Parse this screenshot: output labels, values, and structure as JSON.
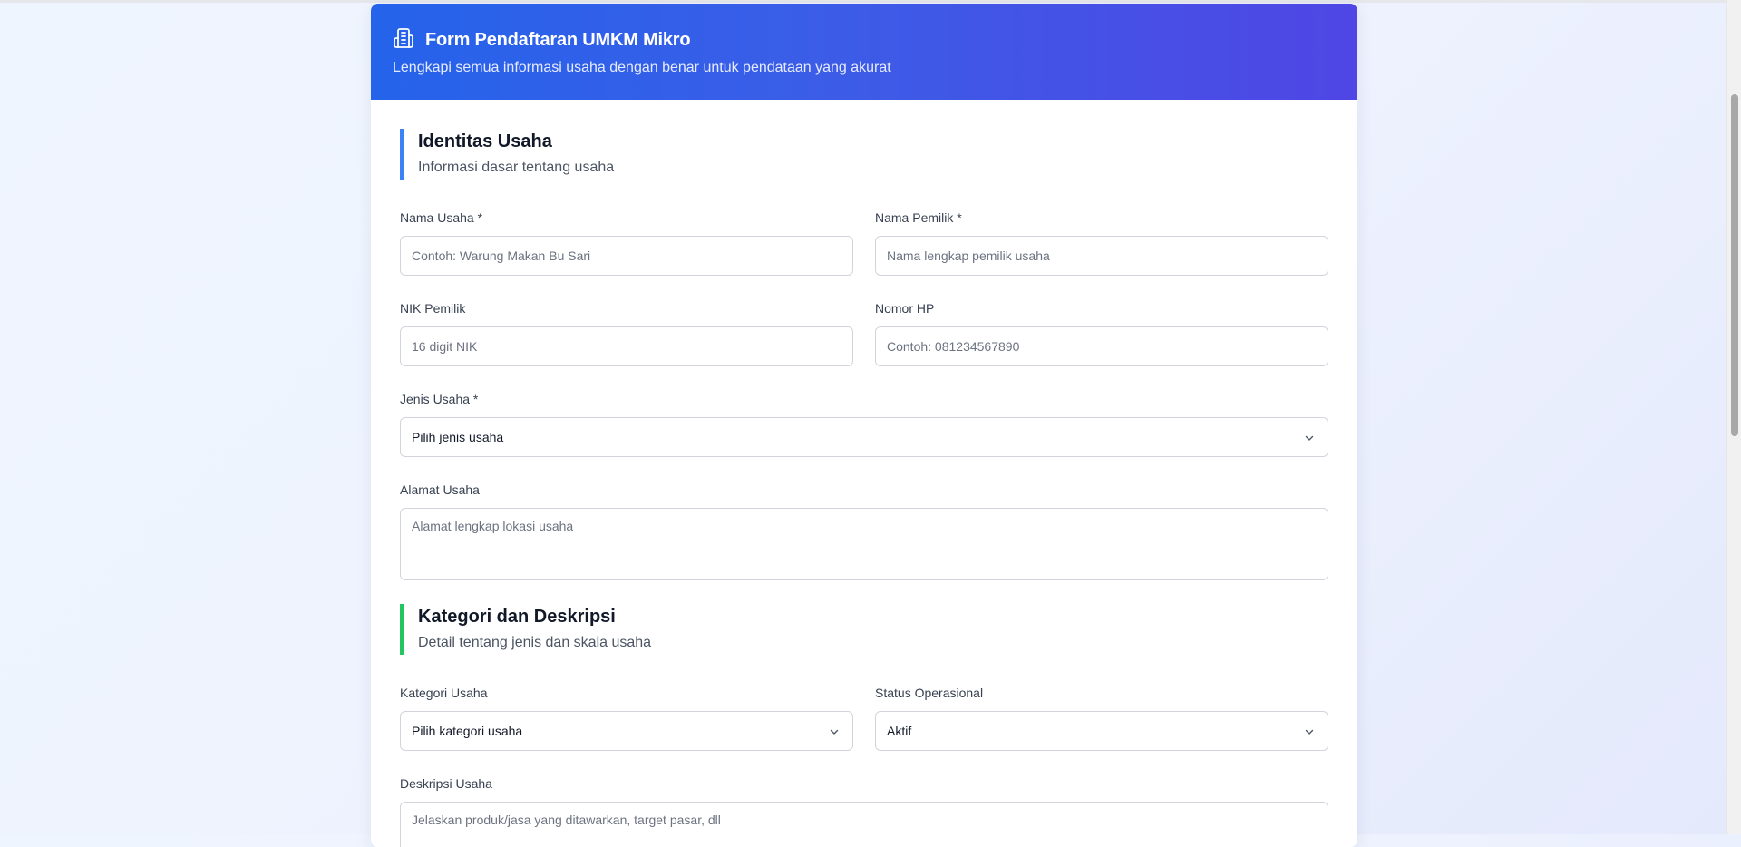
{
  "header": {
    "title": "Form Pendaftaran UMKM Mikro",
    "subtitle": "Lengkapi semua informasi usaha dengan benar untuk pendataan yang akurat",
    "icon": "building-icon"
  },
  "sections": [
    {
      "title": "Identitas Usaha",
      "description": "Informasi dasar tentang usaha",
      "accent_color": "#3b82f6"
    },
    {
      "title": "Kategori dan Deskripsi",
      "description": "Detail tentang jenis dan skala usaha",
      "accent_color": "#22c55e"
    }
  ],
  "fields": {
    "nama_usaha": {
      "label": "Nama Usaha *",
      "placeholder": "Contoh: Warung Makan Bu Sari",
      "value": ""
    },
    "nama_pemilik": {
      "label": "Nama Pemilik *",
      "placeholder": "Nama lengkap pemilik usaha",
      "value": ""
    },
    "nik_pemilik": {
      "label": "NIK Pemilik",
      "placeholder": "16 digit NIK",
      "value": ""
    },
    "nomor_hp": {
      "label": "Nomor HP",
      "placeholder": "Contoh: 081234567890",
      "value": ""
    },
    "jenis_usaha": {
      "label": "Jenis Usaha *",
      "selected": "Pilih jenis usaha"
    },
    "alamat_usaha": {
      "label": "Alamat Usaha",
      "placeholder": "Alamat lengkap lokasi usaha",
      "value": ""
    },
    "kategori_usaha": {
      "label": "Kategori Usaha",
      "selected": "Pilih kategori usaha"
    },
    "status_operasional": {
      "label": "Status Operasional",
      "selected": "Aktif"
    },
    "deskripsi_usaha": {
      "label": "Deskripsi Usaha",
      "placeholder": "Jelaskan produk/jasa yang ditawarkan, target pasar, dll",
      "value": ""
    }
  },
  "colors": {
    "header_gradient_start": "#2563eb",
    "header_gradient_end": "#4f46e5",
    "section_identity_accent": "#3b82f6",
    "section_category_accent": "#22c55e"
  }
}
